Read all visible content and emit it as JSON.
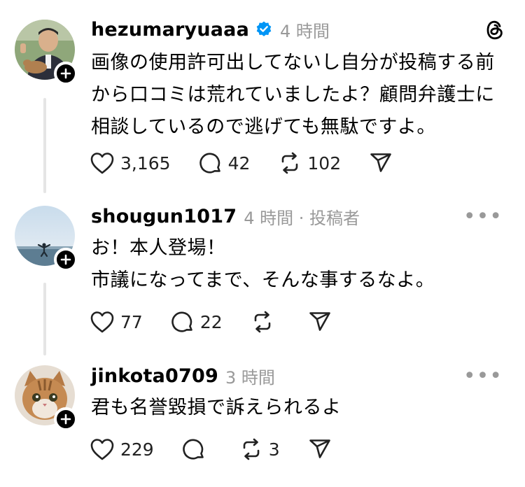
{
  "posts": [
    {
      "username": "hezumaryuaaa",
      "verified": true,
      "meta": "4 時間",
      "lines": [
        "画像の使用許可出してないし自分が投稿する前",
        "から口コミは荒れていましたよ？顧問弁護士に",
        "相談しているので逃げても無駄ですよ。"
      ],
      "likes": "3,165",
      "comments": "42",
      "reposts": "102"
    },
    {
      "username": "shougun1017",
      "meta": "4 時間 · 投稿者",
      "lines": [
        "お！本人登場！",
        "市議になってまで、そんな事するなよ。"
      ],
      "likes": "77",
      "comments": "22",
      "reposts": ""
    },
    {
      "username": "jinkota0709",
      "meta": "3 時間",
      "lines": [
        "君も名誉毀損で訴えられるよ"
      ],
      "likes": "229",
      "comments": "",
      "reposts": "3"
    }
  ],
  "icons": {
    "app": "threads-logo-icon",
    "like": "heart-icon",
    "comment": "comment-bubble-icon",
    "repost": "repost-icon",
    "share": "send-icon",
    "follow": "plus-icon",
    "verified": "verified-badge-icon",
    "more": "more-icon"
  },
  "colors": {
    "verified": "#0095f6",
    "meta": "#999999",
    "line": "#e5e5e5"
  }
}
